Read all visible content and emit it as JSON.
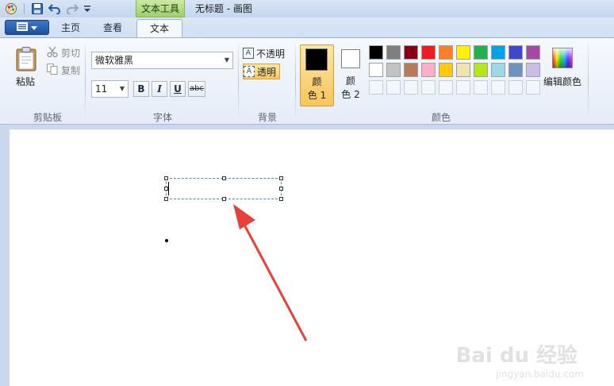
{
  "titlebar": {
    "context_tab": "文本工具",
    "window_title": "无标题 - 画图"
  },
  "tabs": {
    "home": "主页",
    "view": "查看",
    "text": "文本"
  },
  "clipboard": {
    "paste": "粘贴",
    "cut": "剪切",
    "copy": "复制",
    "group": "剪贴板"
  },
  "font": {
    "family": "微软雅黑",
    "size": "11",
    "bold": "B",
    "italic": "I",
    "underline": "U",
    "strike": "abc",
    "group": "字体"
  },
  "background": {
    "opaque": "不透明",
    "transparent": "透明",
    "group": "背景"
  },
  "colors": {
    "color1_line1": "颜",
    "color1_line2": "色 1",
    "color2_line1": "颜",
    "color2_line2": "色 2",
    "color1_value": "#000000",
    "color2_value": "#ffffff",
    "edit": "编辑颜色",
    "group": "颜色",
    "palette_row1": [
      "#000000",
      "#7f7f7f",
      "#880015",
      "#ed1c24",
      "#ff7f27",
      "#fff200",
      "#22b14c",
      "#00a2e8",
      "#3f48cc",
      "#a349a4"
    ],
    "palette_row2": [
      "#ffffff",
      "#c3c3c3",
      "#b97a57",
      "#ffaec9",
      "#ffc90e",
      "#efe4b0",
      "#b5e61d",
      "#99d9ea",
      "#7092be",
      "#c8bfe7"
    ]
  },
  "canvas": {
    "watermark": "Bai du 经验",
    "watermark_url": "jingyan.baidu.com",
    "arrow_color": "#e8413c"
  }
}
